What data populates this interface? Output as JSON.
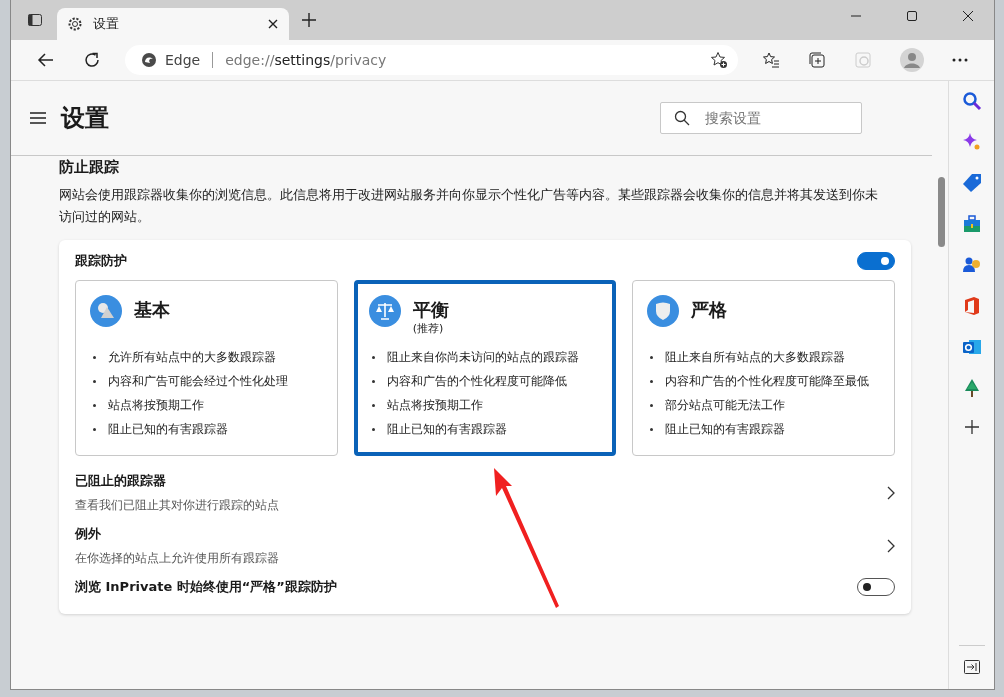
{
  "tabs": [
    {
      "label": "设置",
      "selected": true
    }
  ],
  "address_bar": {
    "site_label": "Edge",
    "url_scheme": "edge://",
    "url_host": "settings",
    "url_path": "/privacy"
  },
  "header": {
    "title": "设置",
    "search": {
      "placeholder": "搜索设置"
    }
  },
  "section": {
    "heading": "防止跟踪",
    "description": "网站会使用跟踪器收集你的浏览信息。此信息将用于改进网站服务并向你显示个性化广告等内容。某些跟踪器会收集你的信息并将其发送到你未访问过的网站。"
  },
  "tracking_prevention": {
    "label": "跟踪防护",
    "on": true,
    "levels": [
      {
        "kind": "basic",
        "title": "基本",
        "selected": false,
        "points": [
          "允许所有站点中的大多数跟踪器",
          "内容和广告可能会经过个性化处理",
          "站点将按预期工作",
          "阻止已知的有害跟踪器"
        ]
      },
      {
        "kind": "balanced",
        "title": "平衡",
        "subtitle": "(推荐)",
        "selected": true,
        "points": [
          "阻止来自你尚未访问的站点的跟踪器",
          "内容和广告的个性化程度可能降低",
          "站点将按预期工作",
          "阻止已知的有害跟踪器"
        ]
      },
      {
        "kind": "strict",
        "title": "严格",
        "selected": false,
        "points": [
          "阻止来自所有站点的大多数跟踪器",
          "内容和广告的个性化程度可能降至最低",
          "部分站点可能无法工作",
          "阻止已知的有害跟踪器"
        ]
      }
    ]
  },
  "rows": [
    {
      "kind": "link",
      "title": "已阻止的跟踪器",
      "description": "查看我们已阻止其对你进行跟踪的站点"
    },
    {
      "kind": "link",
      "title": "例外",
      "description": "在你选择的站点上允许使用所有跟踪器"
    },
    {
      "kind": "toggle",
      "title": "浏览 InPrivate 时始终使用“严格”跟踪防护",
      "on": false
    }
  ]
}
